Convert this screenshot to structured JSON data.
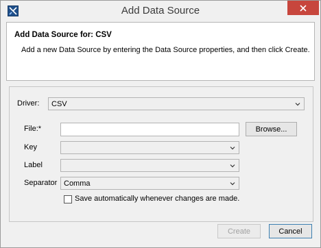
{
  "window": {
    "title": "Add Data Source"
  },
  "header": {
    "title": "Add Data Source for: CSV",
    "description": "Add a new Data Source by entering the Data Source properties, and then click Create."
  },
  "form": {
    "driver_label": "Driver:",
    "driver_value": "CSV",
    "file_label": "File:*",
    "file_value": "",
    "browse_label": "Browse...",
    "key_label": "Key",
    "key_value": "",
    "label_label": "Label",
    "label_value": "",
    "separator_label": "Separator",
    "separator_value": "Comma",
    "autosave_label": "Save automatically whenever changes are made.",
    "autosave_checked": false
  },
  "footer": {
    "create_label": "Create",
    "cancel_label": "Cancel"
  },
  "colors": {
    "close_button": "#c7463d",
    "panel_bg": "#f0f0f0"
  },
  "icons": [
    "app-logo-icon",
    "close-icon",
    "chevron-down-icon"
  ]
}
